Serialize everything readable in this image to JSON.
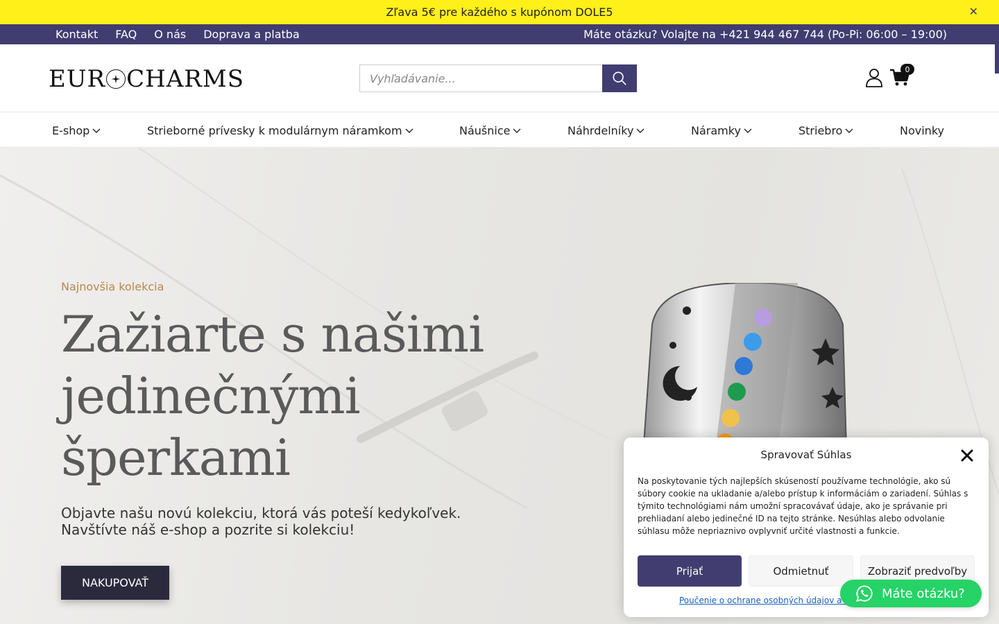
{
  "promo": {
    "text": "Zľava 5€ pre každého s kupónom DOLE5",
    "close": "✕"
  },
  "top_nav": {
    "links": [
      "Kontakt",
      "FAQ",
      "O nás",
      "Doprava a platba"
    ],
    "phone": "Máte otázku? Volajte na +421 944 467 744 (Po-Pi: 06:00 – 19:00)"
  },
  "header": {
    "logo_left": "EUR",
    "logo_right": "CHARMS",
    "search_placeholder": "Vyhľadávanie...",
    "cart_count": "0"
  },
  "main_nav": [
    {
      "label": "E-shop",
      "dropdown": true
    },
    {
      "label": "Strieborné prívesky k modulárnym náramkom",
      "dropdown": true
    },
    {
      "label": "Náušnice",
      "dropdown": true
    },
    {
      "label": "Náhrdelníky",
      "dropdown": true
    },
    {
      "label": "Náramky",
      "dropdown": true
    },
    {
      "label": "Striebro",
      "dropdown": true
    },
    {
      "label": "Novinky",
      "dropdown": false
    }
  ],
  "hero": {
    "tagline": "Najnovšia kolekcia",
    "title": "Zažiarte s našimi jedinečnými šperkami",
    "subtitle_1": "Objavte našu novú kolekciu, ktorá vás poteší kedykoľvek.",
    "subtitle_2": "Navštívte náš e-shop a pozrite si kolekciu!",
    "button": "NAKUPOVAŤ"
  },
  "cookie": {
    "title": "Spravovať Súhlas",
    "text": "Na poskytovanie tých najlepších skúseností používame technológie, ako sú súbory cookie na ukladanie a/alebo prístup k informáciám o zariadení. Súhlas s týmito technológiami nám umožní spracovávať údaje, ako je správanie pri prehliadaní alebo jedinečné ID na tejto stránke. Nesúhlas alebo odvolanie súhlasu môže nepriaznivo ovplyvniť určité vlastnosti a funkcie.",
    "accept": "Prijať",
    "deny": "Odmietnuť",
    "prefs": "Zobraziť predvoľby",
    "link": "Poučenie o ochrane osobných údajov a cookies"
  },
  "whatsapp": {
    "label": "Máte otázku?"
  },
  "colors": {
    "brand": "#413d71",
    "promo": "#fff01a",
    "accent": "#b8864f",
    "whatsapp": "#25d366"
  },
  "icons": [
    "close-icon",
    "search-icon",
    "user-icon",
    "cart-icon",
    "chevron-down-icon",
    "whatsapp-icon"
  ]
}
